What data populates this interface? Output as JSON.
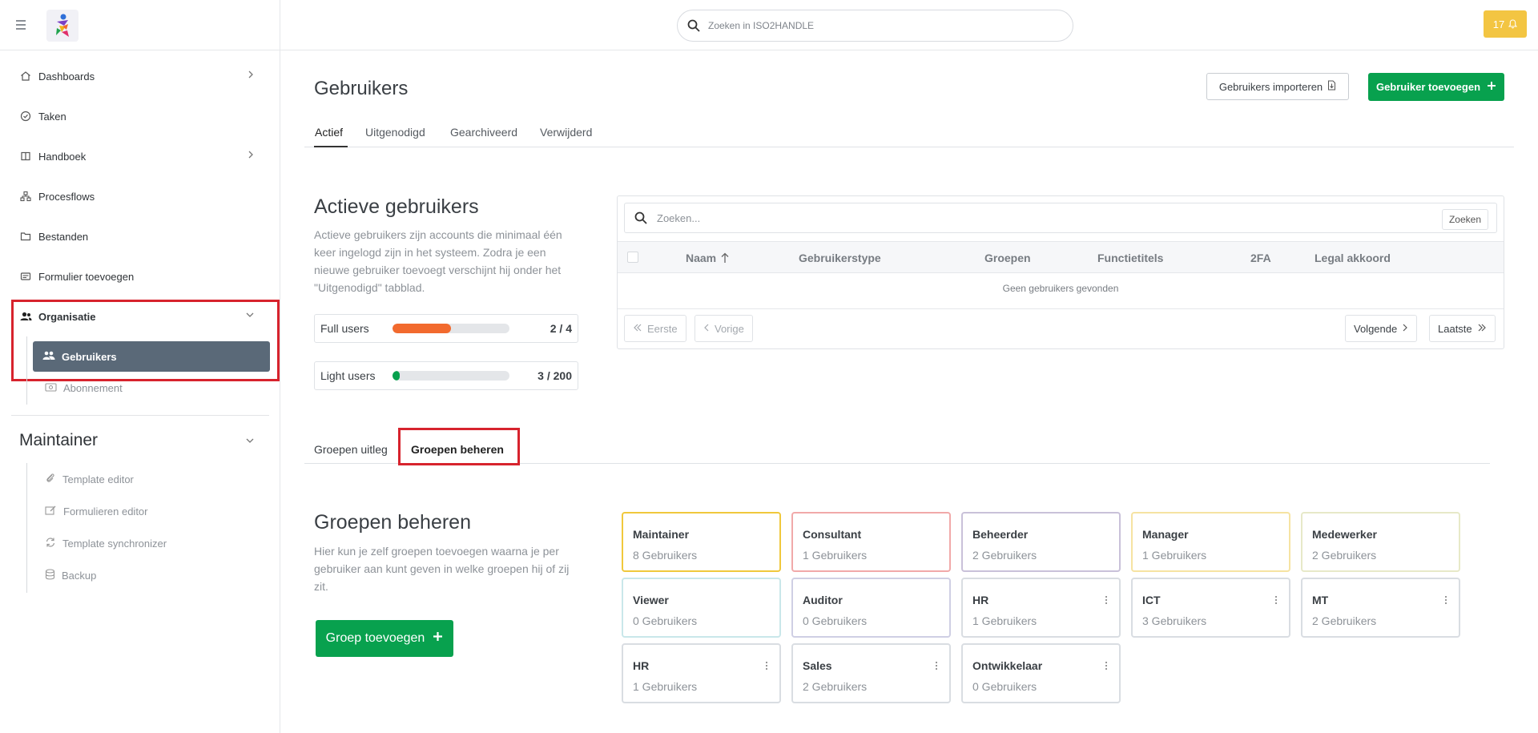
{
  "header": {
    "search_placeholder": "Zoeken in ISO2HANDLE",
    "notifications_count": "17"
  },
  "sidebar": {
    "items": [
      {
        "label": "Dashboards",
        "icon": "home-icon",
        "has_chevron": true
      },
      {
        "label": "Taken",
        "icon": "check-circle-icon",
        "has_chevron": false
      },
      {
        "label": "Handboek",
        "icon": "book-icon",
        "has_chevron": true
      },
      {
        "label": "Procesflows",
        "icon": "flow-icon",
        "has_chevron": false
      },
      {
        "label": "Bestanden",
        "icon": "folder-icon",
        "has_chevron": false
      },
      {
        "label": "Formulier toevoegen",
        "icon": "form-icon",
        "has_chevron": false
      }
    ],
    "organisatie": {
      "label": "Organisatie",
      "sub_items": [
        {
          "label": "Gebruikers",
          "active": true
        },
        {
          "label": "Abonnement",
          "active": false
        }
      ]
    },
    "maintainer": {
      "label": "Maintainer",
      "sub_items": [
        {
          "label": "Template editor"
        },
        {
          "label": "Formulieren editor"
        },
        {
          "label": "Template synchronizer"
        },
        {
          "label": "Backup"
        }
      ]
    }
  },
  "main": {
    "title": "Gebruikers",
    "import_button": "Gebruikers importeren",
    "add_button": "Gebruiker toevoegen",
    "tabs": [
      "Actief",
      "Uitgenodigd",
      "Gearchiveerd",
      "Verwijderd"
    ],
    "active_tab": "Actief",
    "active_section": {
      "title": "Actieve gebruikers",
      "description": "Actieve gebruikers zijn accounts die minimaal één keer ingelogd zijn in het systeem. Zodra je een nieuwe gebruiker toevoegt verschijnt hij onder het \"Uitgenodigd\" tabblad.",
      "usage": [
        {
          "label": "Full users",
          "count": "2 / 4",
          "fraction": 0.5,
          "color": "#f26a2e"
        },
        {
          "label": "Light users",
          "count": "3 / 200",
          "fraction": 0.015,
          "color": "#08a14e"
        }
      ]
    },
    "table": {
      "search_placeholder": "Zoeken...",
      "search_button": "Zoeken",
      "columns": [
        "Naam",
        "Gebruikerstype",
        "Groepen",
        "Functietitels",
        "2FA",
        "Legal akkoord"
      ],
      "empty_text": "Geen gebruikers gevonden",
      "pagination": {
        "first": "Eerste",
        "prev": "Vorige",
        "next": "Volgende",
        "last": "Laatste"
      }
    },
    "group_tabs": [
      "Groepen uitleg",
      "Groepen beheren"
    ],
    "active_group_tab": "Groepen beheren",
    "groups_section": {
      "title": "Groepen beheren",
      "description": "Hier kun je zelf groepen toevoegen waarna je per gebruiker aan kunt geven in welke groepen hij of zij zit.",
      "add_button": "Groep toevoegen"
    },
    "groups": [
      {
        "name": "Maintainer",
        "count": "8 Gebruikers",
        "border": "#f0c83c",
        "menu": false
      },
      {
        "name": "Consultant",
        "count": "1 Gebruikers",
        "border": "#f1a9a9",
        "menu": false
      },
      {
        "name": "Beheerder",
        "count": "2 Gebruikers",
        "border": "#c9c1d9",
        "menu": false
      },
      {
        "name": "Manager",
        "count": "1 Gebruikers",
        "border": "#f6e3a2",
        "menu": false
      },
      {
        "name": "Medewerker",
        "count": "2 Gebruikers",
        "border": "#e7e9c8",
        "menu": false
      },
      {
        "name": "Viewer",
        "count": "0 Gebruikers",
        "border": "#c9e7ea",
        "menu": false
      },
      {
        "name": "Auditor",
        "count": "0 Gebruikers",
        "border": "#cfcfe4",
        "menu": false
      },
      {
        "name": "HR",
        "count": "1 Gebruikers",
        "border": "#d9dde2",
        "menu": true
      },
      {
        "name": "ICT",
        "count": "3 Gebruikers",
        "border": "#d9dde2",
        "menu": true
      },
      {
        "name": "MT",
        "count": "2 Gebruikers",
        "border": "#d9dde2",
        "menu": true
      },
      {
        "name": "HR",
        "count": "1 Gebruikers",
        "border": "#d9dde2",
        "menu": true
      },
      {
        "name": "Sales",
        "count": "2 Gebruikers",
        "border": "#d9dde2",
        "menu": true
      },
      {
        "name": "Ontwikkelaar",
        "count": "0 Gebruikers",
        "border": "#d9dde2",
        "menu": true
      }
    ]
  }
}
